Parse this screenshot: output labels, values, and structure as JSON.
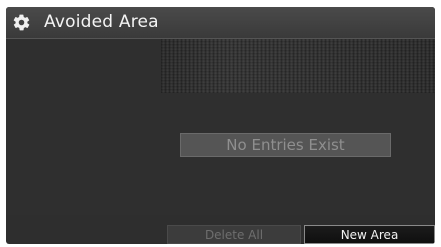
{
  "header": {
    "title": "Avoided Area",
    "icon": "gear-icon"
  },
  "list": {
    "empty_message": "No Entries Exist"
  },
  "actions": {
    "delete_all_label": "Delete All",
    "delete_all_enabled": false,
    "new_area_label": "New Area",
    "new_area_enabled": true
  },
  "colors": {
    "background": "#2e2e2e",
    "title_text": "#f4f4f4",
    "disabled_text": "#6e6e6e",
    "placeholder_text": "#8f8f8f"
  }
}
